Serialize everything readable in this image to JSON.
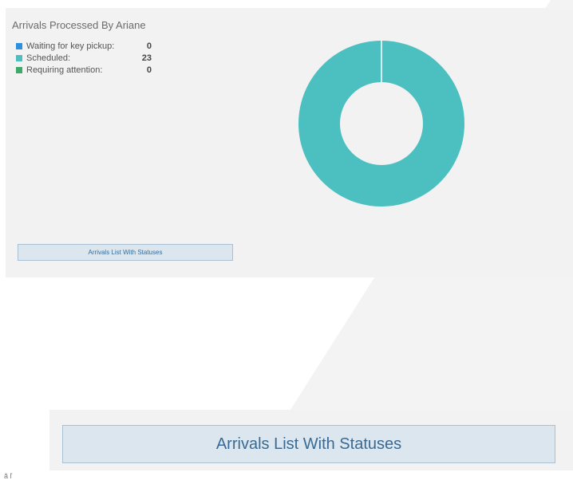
{
  "widget": {
    "title": "Arrivals Processed By Ariane",
    "legend": [
      {
        "label": "Waiting for key pickup:",
        "count": "0",
        "color": "#2d8fe0"
      },
      {
        "label": "Scheduled:",
        "count": "23",
        "color": "#4cc0c0"
      },
      {
        "label": "Requiring attention:",
        "count": "0",
        "color": "#3daa6a"
      }
    ],
    "list_button_label": "Arrivals List With Statuses"
  },
  "zoom": {
    "button_label": "Arrivals List With Statuses"
  },
  "corner_text": "ă ľ",
  "colors": {
    "panel_bg": "#f2f2f2",
    "button_bg": "#dbe6ef",
    "button_text": "#3a6a93",
    "donut_fill": "#4cc0c0"
  },
  "chart_data": {
    "type": "pie",
    "style": "donut",
    "categories": [
      "Waiting for key pickup",
      "Scheduled",
      "Requiring attention"
    ],
    "values": [
      0,
      23,
      0
    ],
    "colors": [
      "#2d8fe0",
      "#4cc0c0",
      "#3daa6a"
    ]
  }
}
